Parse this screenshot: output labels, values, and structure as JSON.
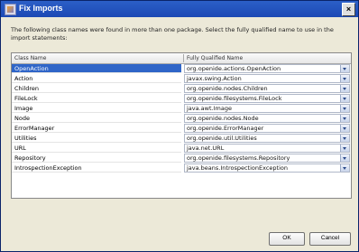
{
  "window": {
    "title": "Fix Imports",
    "close_label": "×"
  },
  "message": "The following class names were found in more than one package. Select the fully qualified name to use in the import statements:",
  "table": {
    "headers": [
      "Class Name",
      "Fully Qualified Name"
    ],
    "rows": [
      {
        "cls": "OpenAction",
        "fqn": "org.openide.actions.OpenAction",
        "selected": true
      },
      {
        "cls": "Action",
        "fqn": "javax.swing.Action",
        "selected": false
      },
      {
        "cls": "Children",
        "fqn": "org.openide.nodes.Children",
        "selected": false
      },
      {
        "cls": "FileLock",
        "fqn": "org.openide.filesystems.FileLock",
        "selected": false
      },
      {
        "cls": "Image",
        "fqn": "java.awt.Image",
        "selected": false
      },
      {
        "cls": "Node",
        "fqn": "org.openide.nodes.Node",
        "selected": false
      },
      {
        "cls": "ErrorManager",
        "fqn": "org.openide.ErrorManager",
        "selected": false
      },
      {
        "cls": "Utilities",
        "fqn": "org.openide.util.Utilities",
        "selected": false
      },
      {
        "cls": "URL",
        "fqn": "java.net.URL",
        "selected": false
      },
      {
        "cls": "Repository",
        "fqn": "org.openide.filesystems.Repository",
        "selected": false
      },
      {
        "cls": "IntrospectionException",
        "fqn": "java.beans.IntrospectionException",
        "selected": false
      }
    ]
  },
  "buttons": {
    "ok": "OK",
    "cancel": "Cancel"
  },
  "colors": {
    "title_bar": "#1c49b4",
    "selection": "#2f65c8"
  }
}
